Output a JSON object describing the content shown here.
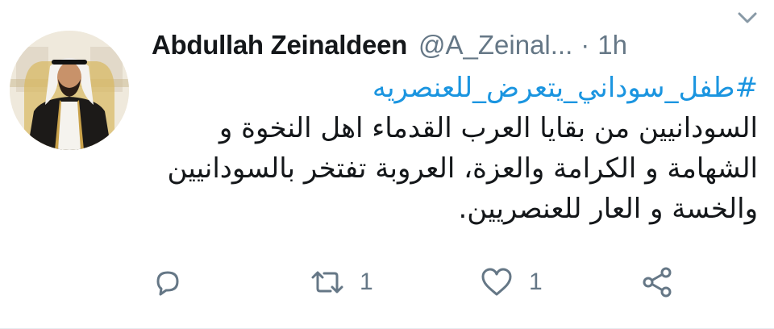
{
  "tweet": {
    "display_name": "Abdullah Zeinaldeen",
    "handle": "@A_Zeinal...",
    "separator": "·",
    "time": "1h",
    "hashtag": "#طفل_سوداني_يتعرض_للعنصريه",
    "text": "السودانيين من بقايا العرب القدماء اهل النخوة و الشهامة و الكرامة والعزة، العروبة تفتخر بالسودانيين والخسة و العار للعنصريين.",
    "hashtag_color": "#1b95e0",
    "secondary_color": "#657786"
  },
  "actions": {
    "reply": {
      "icon": "reply-icon",
      "count": ""
    },
    "retweet": {
      "icon": "retweet-icon",
      "count": "1"
    },
    "like": {
      "icon": "heart-icon",
      "count": "1"
    },
    "share": {
      "icon": "share-icon",
      "count": ""
    }
  }
}
